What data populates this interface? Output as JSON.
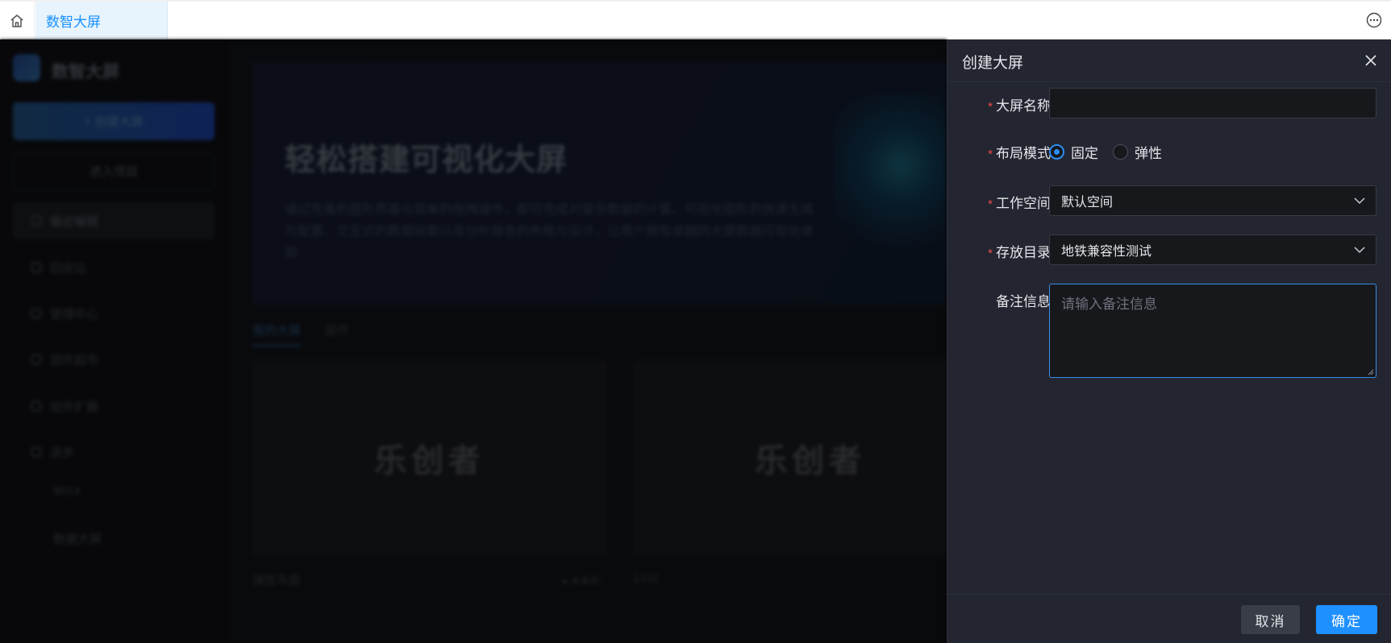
{
  "tabbar": {
    "home_icon": "home-icon",
    "active_tab": "数智大屏",
    "more_icon": "more-icon"
  },
  "background": {
    "brand": "数智大屏",
    "create_button": "+ 创建大屏",
    "enter_project": "进入项目",
    "nav": [
      "最近编辑",
      "回收站",
      "管理中心",
      "部件超市",
      "组件扩展",
      "进步"
    ],
    "sub_items": [
      "9014",
      "数据大屏"
    ],
    "banner_title": "轻松搭建可视化大屏",
    "banner_desc": "通过完善的图形界面与简单的拖拽操作，即可完成对复杂数据的计算、可视化图形的快速生成与配置、交互式的数据探索以及分析报告的布局与设计，让用户拥有卓越的大屏数据可视化体验",
    "tabs": [
      "我的大屏",
      "部件"
    ],
    "cards": [
      {
        "name": "弹性布局",
        "status": "● 未发布",
        "logo": "乐创者"
      },
      {
        "name": "1211",
        "logo": "乐创者"
      }
    ]
  },
  "drawer": {
    "title": "创建大屏",
    "close_icon": "close-icon",
    "fields": {
      "name": {
        "label": "大屏名称",
        "required": true,
        "value": ""
      },
      "layout": {
        "label": "布局模式",
        "required": true,
        "options": [
          "固定",
          "弹性"
        ],
        "selected": "固定"
      },
      "workspace": {
        "label": "工作空间",
        "required": true,
        "value": "默认空间"
      },
      "directory": {
        "label": "存放目录",
        "required": true,
        "value": "地铁兼容性测试"
      },
      "remark": {
        "label": "备注信息",
        "required": false,
        "placeholder": "请输入备注信息"
      }
    },
    "cancel_label": "取消",
    "ok_label": "确定"
  },
  "colors": {
    "accent": "#1e90ff",
    "drawer_bg": "#232630",
    "required": "#f5484a"
  }
}
